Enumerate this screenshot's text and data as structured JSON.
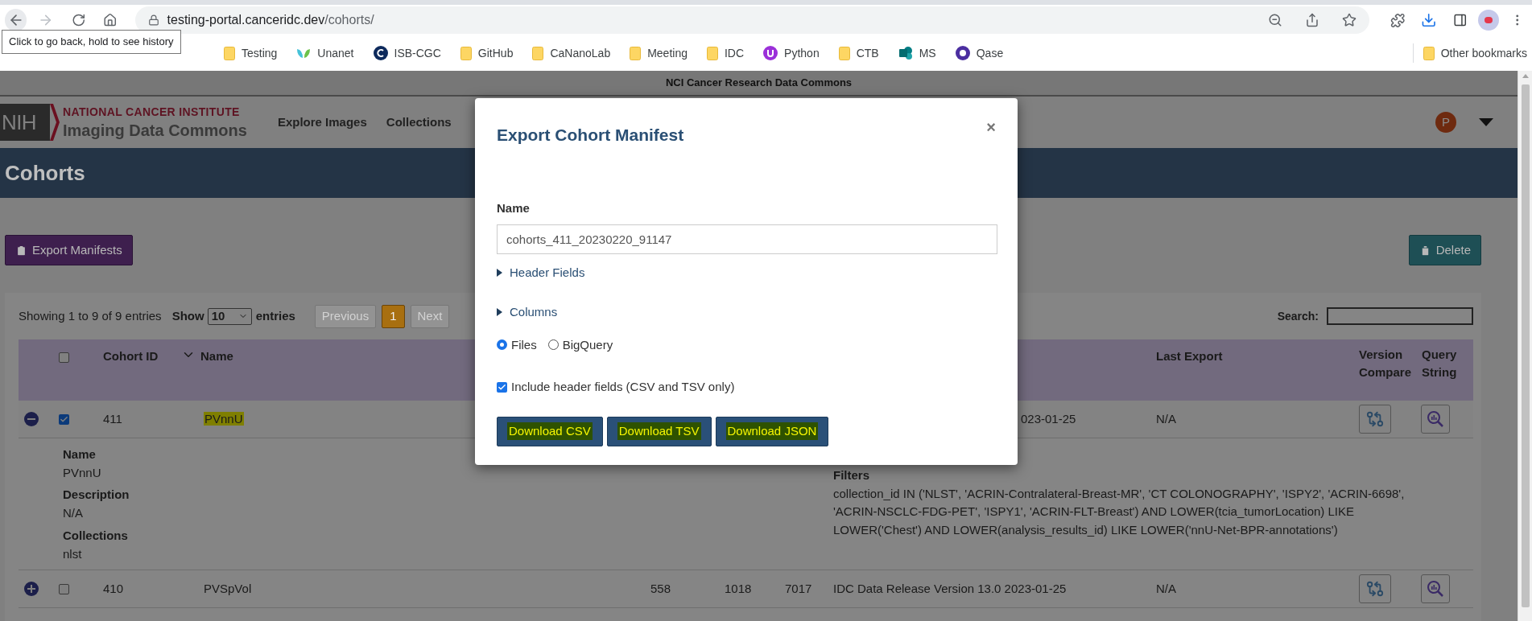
{
  "browser": {
    "url_domain": "testing-portal.canceridc.dev",
    "url_path": "/cohorts/",
    "tooltip": "Click to go back, hold to see history",
    "bookmarks": [
      {
        "label": "Testing",
        "kind": "folder"
      },
      {
        "label": "Unanet",
        "kind": "leaf"
      },
      {
        "label": "ISB-CGC",
        "kind": "disc"
      },
      {
        "label": "GitHub",
        "kind": "folder"
      },
      {
        "label": "CaNanoLab",
        "kind": "folder"
      },
      {
        "label": "Meeting",
        "kind": "folder"
      },
      {
        "label": "IDC",
        "kind": "folder"
      },
      {
        "label": "Python",
        "kind": "badge"
      },
      {
        "label": "CTB",
        "kind": "folder"
      },
      {
        "label": "MS",
        "kind": "tiles"
      },
      {
        "label": "Qase",
        "kind": "ring"
      }
    ],
    "other_bookmarks": "Other bookmarks"
  },
  "page": {
    "banner": "NCI Cancer Research Data Commons",
    "logo": "NIH",
    "agency": "NATIONAL CANCER INSTITUTE",
    "product": "Imaging Data Commons",
    "nav": [
      "Explore Images",
      "Collections"
    ],
    "user_initial": "P",
    "title": "Cohorts",
    "export_button": "Export Manifests",
    "delete_button": "Delete"
  },
  "table": {
    "info": "Showing 1 to 9 of 9 entries",
    "show_label": "Show",
    "page_size": "10",
    "entries_label": "entries",
    "pager": [
      {
        "label": "Previous",
        "selected": false,
        "disabled": true
      },
      {
        "label": "1",
        "selected": true,
        "disabled": false
      },
      {
        "label": "Next",
        "selected": false,
        "disabled": true
      }
    ],
    "search_label": "Search:",
    "select_all": false,
    "columns": {
      "id": "Cohort ID",
      "name": "Name",
      "last_export": "Last Export",
      "version_compare": "Version Compare",
      "query_string": "Query String"
    },
    "rows": [
      {
        "expanded": true,
        "checked": true,
        "name_highlighted": true,
        "id": "411",
        "name": "PVnnU",
        "column_8": "023-01-25",
        "last_export": "N/A",
        "detail": {
          "name_label": "Name",
          "name": "PVnnU",
          "description_label": "Description",
          "description": "N/A",
          "collections_label": "Collections",
          "collections": "nlst",
          "filters_label": "Filters",
          "filters": "collection_id IN ('NLST', 'ACRIN-Contralateral-Breast-MR', 'CT COLONOGRAPHY', 'ISPY2', 'ACRIN-6698', 'ACRIN-NSCLC-FDG-PET', 'ISPY1', 'ACRIN-FLT-Breast') AND LOWER(tcia_tumorLocation) LIKE LOWER('Chest') AND LOWER(analysis_results_id) LIKE LOWER('nnU-Net-BPR-annotations')"
        }
      },
      {
        "expanded": false,
        "checked": false,
        "name_highlighted": false,
        "id": "410",
        "name": "PVSpVol",
        "column_5": "558",
        "column_6": "1018",
        "column_7": "7017",
        "column_8": "IDC Data Release Version 13.0 2023-01-25",
        "last_export": "N/A"
      }
    ]
  },
  "modal": {
    "title": "Export Cohort Manifest",
    "close": "×",
    "name_label": "Name",
    "name_value": "cohorts_411_20230220_91147",
    "sections": [
      {
        "label": "Header Fields",
        "expanded": false
      },
      {
        "label": "Columns",
        "expanded": false
      }
    ],
    "formats": [
      {
        "label": "Files",
        "selected": true
      },
      {
        "label": "BigQuery",
        "selected": false
      }
    ],
    "include_header": {
      "label": "Include header fields (CSV and TSV only)",
      "checked": true
    },
    "buttons": [
      "Download CSV",
      "Download TSV",
      "Download JSON"
    ]
  }
}
